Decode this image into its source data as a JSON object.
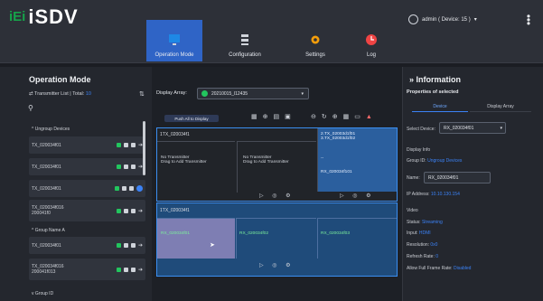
{
  "app": {
    "brand_mark": "iEi",
    "brand_name": "iSDV",
    "admin_label": "admin ( Device: 15 )",
    "nav": [
      {
        "label": "Operation Mode",
        "icon": "monitor-icon",
        "active": true,
        "color": "#1e88e5"
      },
      {
        "label": "Configuration",
        "icon": "server-icon",
        "active": false,
        "color": "#cfd3da"
      },
      {
        "label": "Settings",
        "icon": "gear-icon",
        "active": false,
        "color": "#f59e0b"
      },
      {
        "label": "Log",
        "icon": "clock-icon",
        "active": false,
        "color": "#ef4444"
      }
    ]
  },
  "left": {
    "title": "Operation Mode",
    "tx_list": "Transmitter List",
    "total_label": "Total:",
    "total_value": "10",
    "groups": [
      {
        "name": "Ungroup Devices",
        "items": [
          "TX_020034f01",
          "TX_020034f01",
          "TX_020034f01",
          "TX_020034f016\n200041f0"
        ]
      },
      {
        "name": "Group Name A",
        "items": [
          "TX_020034f01",
          "TX_020034f016\n200041f013"
        ]
      },
      {
        "name": "Group ID",
        "items": []
      }
    ]
  },
  "main": {
    "display_array_label": "Display Array:",
    "display_array_value": "20210015_l12435",
    "push_label": "Push All to Display",
    "row1_head": "1TX_020034f1",
    "cell_a": "No Transmitter\nDrag to Add Transmitter",
    "cell_b": "No Transmitter\nDrag to Add Transmitter",
    "cell_c_top": "2.TX_02003d1f01\n3.TX_02003d1f02",
    "cell_c_dash": "--",
    "cell_c_rx": "RX_020034f101",
    "row2_head": "1TX_020034f1",
    "rx1": "RX_020034f01",
    "rx2": "RX_020034f02",
    "rx3": "RX_020034f03"
  },
  "right": {
    "title": "Information",
    "subtitle": "Properties of selected",
    "tab_device": "Device",
    "tab_array": "Display Array",
    "select_device_label": "Select Device:",
    "select_device_value": "RX_020034f01",
    "display_info": "Display Info",
    "group_label": "Group ID:",
    "group_value": "Ungroup Devices",
    "name_label": "Name:",
    "name_value": "RX_020034f01",
    "ip_label": "IP Address:",
    "ip_value": "10.10.130.154",
    "video": "Video",
    "status_label": "Status:",
    "status_value": "Streaming",
    "input_label": "Input:",
    "input_value": "HDMI",
    "res_label": "Resolution:",
    "res_value": "0x0",
    "refresh_label": "Refresh Rate:",
    "refresh_value": "0",
    "allow_label": "Allow Full Frame Rate:",
    "allow_value": "Disabled"
  }
}
